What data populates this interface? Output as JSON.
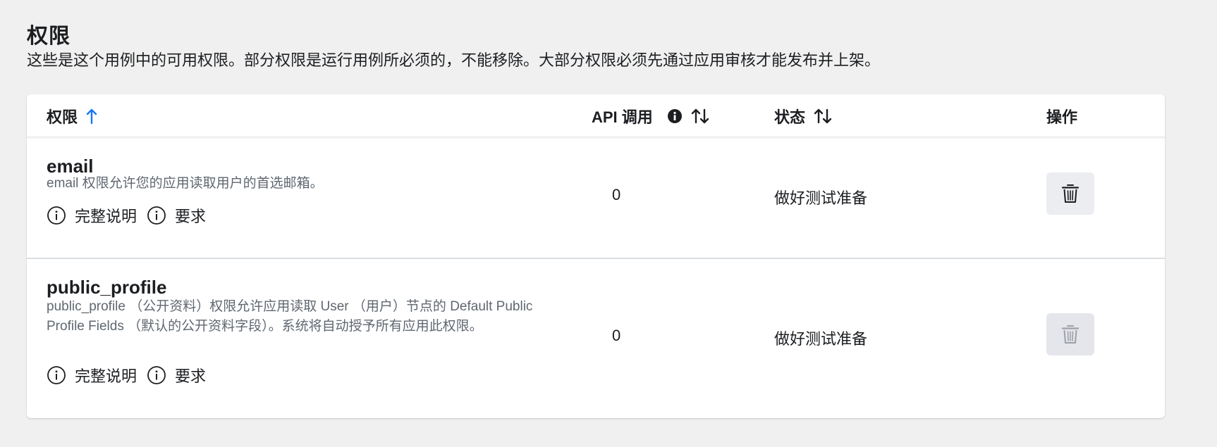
{
  "section": {
    "title": "权限",
    "description": "这些是这个用例中的可用权限。部分权限是运行用例所必须的，不能移除。大部分权限必须先通过应用审核才能发布并上架。"
  },
  "table": {
    "columns": {
      "permission": "权限",
      "api_calls": "API 调用",
      "status": "状态",
      "actions": "操作"
    },
    "rows": [
      {
        "name": "email",
        "description": "email 权限允许您的应用读取用户的首选邮箱。",
        "full_description_link": "完整说明",
        "requirements_link": "要求",
        "api_calls": "0",
        "status": "做好测试准备",
        "delete_enabled": true
      },
      {
        "name": "public_profile",
        "description": "public_profile （公开资料）权限允许应用读取 User （用户）节点的 Default Public Profile Fields （默认的公开资料字段）。系统将自动授予所有应用此权限。",
        "full_description_link": "完整说明",
        "requirements_link": "要求",
        "api_calls": "0",
        "status": "做好测试准备",
        "delete_enabled": false
      }
    ]
  },
  "colors": {
    "sort_active": "#1877f2",
    "text_primary": "#1c1e21",
    "text_secondary": "#606770"
  },
  "icons": {
    "sort_ascending": "arrow-up-icon",
    "sortable": "sort-arrows-icon",
    "info": "info-filled-icon",
    "info_outline": "info-outline-icon",
    "delete": "trash-icon"
  }
}
